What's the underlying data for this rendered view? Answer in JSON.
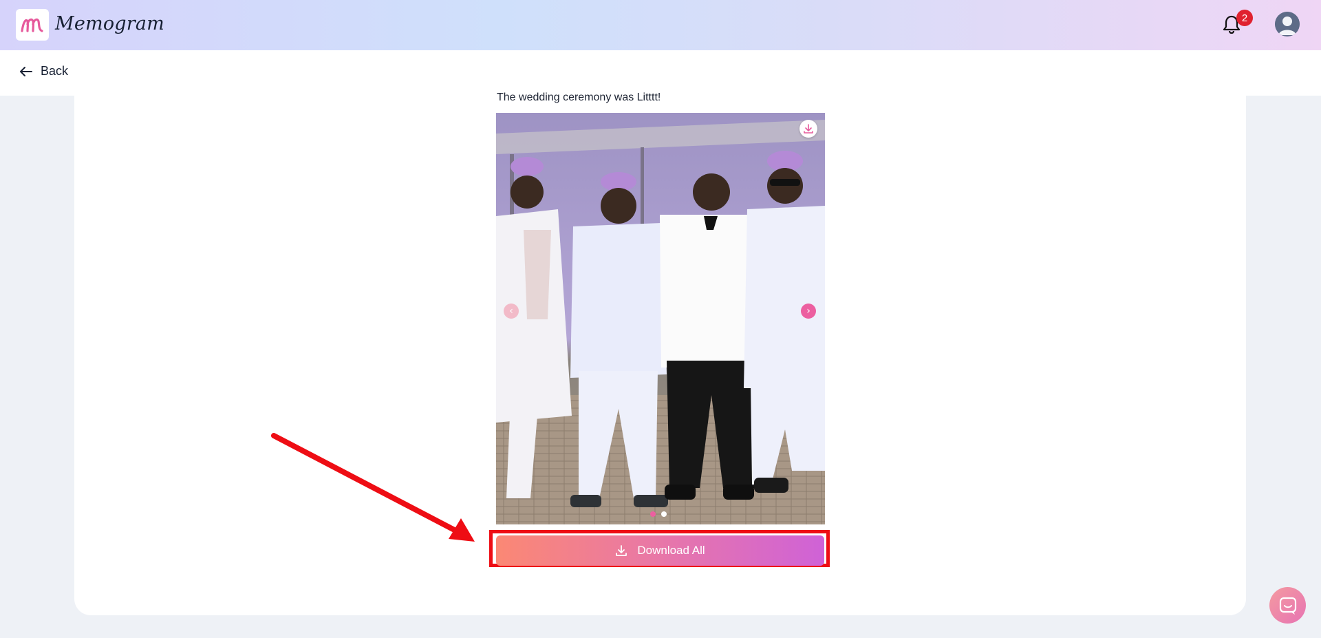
{
  "app": {
    "brand": "Memogram",
    "logo_letter": "m"
  },
  "header": {
    "notification_count": "2"
  },
  "nav": {
    "back_label": "Back"
  },
  "post": {
    "caption": "The wedding ceremony was Litttt!",
    "image_description": "Four men in wedding attire with purple caps",
    "carousel": {
      "total": 2,
      "active_index": 0
    }
  },
  "actions": {
    "download_all_label": "Download All"
  },
  "colors": {
    "brand_pink": "#ec5fa0",
    "highlight_red": "#ee0d14",
    "badge_red": "#e0212f"
  },
  "icons": [
    "logo-icon",
    "bell-icon",
    "avatar-icon",
    "arrow-left-icon",
    "download-icon",
    "chevron-left-icon",
    "chevron-right-icon",
    "chat-icon"
  ]
}
